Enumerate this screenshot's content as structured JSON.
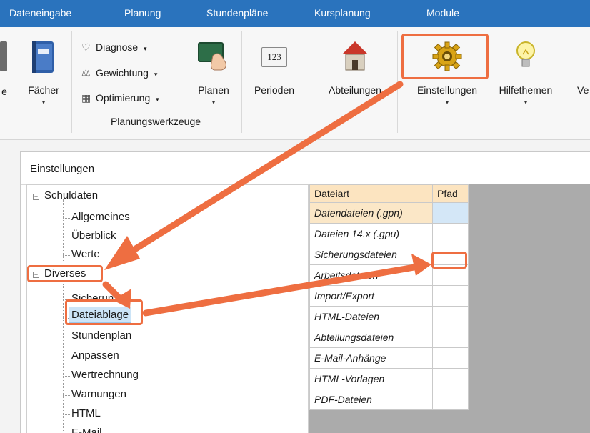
{
  "menubar": {
    "items": [
      "Dateneingabe",
      "Planung",
      "Stundenpläne",
      "Kursplanung",
      "Module"
    ]
  },
  "ribbon": {
    "faecher": "Fächer",
    "cut_left": "e",
    "diagnose": "Diagnose",
    "gewichtung": "Gewichtung",
    "optimierung": "Optimierung",
    "planen": "Planen",
    "group_label": "Planungswerkzeuge",
    "perioden": "Perioden",
    "perioden_icon_text": "123",
    "abteilungen": "Abteilungen",
    "einstellungen": "Einstellungen",
    "hilfethemen": "Hilfethemen",
    "cut_right": "Ve",
    "dropdown_glyph": "▾"
  },
  "dialog": {
    "title": "Einstellungen"
  },
  "tree": {
    "schuldaten": "Schuldaten",
    "allgemeines": "Allgemeines",
    "ueberblick": "Überblick",
    "werte": "Werte",
    "diverses": "Diverses",
    "sicherung": "Sicherun",
    "dateiablage": "Dateiablage",
    "stundenplan": "Stundenplan",
    "anpassen": "Anpassen",
    "wertrechnung": "Wertrechnung",
    "warnungen": "Warnungen",
    "html": "HTML",
    "email": "E-Mail"
  },
  "grid": {
    "headers": [
      "Dateiart",
      "Pfad"
    ],
    "rows": [
      "Datendateien (.gpn)",
      "Dateien 14.x (.gpu)",
      "Sicherungsdateien",
      "Arbeitsdateien",
      "Import/Export",
      "HTML-Dateien",
      "Abteilungsdateien",
      "E-Mail-Anhänge",
      "HTML-Vorlagen",
      "PDF-Dateien"
    ]
  },
  "colors": {
    "menubar": "#2a73bd",
    "annotation": "#ee6e41",
    "grid_header": "#fce4c0",
    "selection": "#cce4f7"
  }
}
